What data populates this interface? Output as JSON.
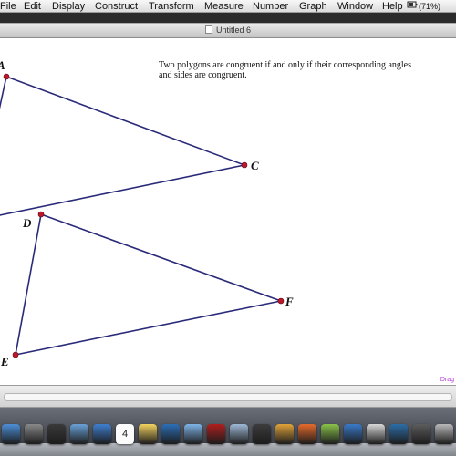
{
  "menubar": {
    "items": [
      "File",
      "Edit",
      "Display",
      "Construct",
      "Transform",
      "Measure",
      "Number",
      "Graph",
      "Window",
      "Help"
    ],
    "battery_text": "(71%)"
  },
  "window": {
    "title": "Untitled 6"
  },
  "canvas": {
    "caption": "Two polygons are congruent if and only if their corresponding angles and sides are congruent.",
    "drag_label": "Drag",
    "points": {
      "A": "A",
      "C": "C",
      "D": "D",
      "E": "E",
      "F": "F"
    },
    "colors": {
      "segment": "#2a2a7a",
      "point": "#c0182a"
    }
  },
  "dock": {
    "icons": [
      "finder-icon",
      "system-icon",
      "app-icon",
      "mail-icon",
      "safari-icon",
      "calendar-icon",
      "notes-icon",
      "iphoto-icon",
      "itunes-icon",
      "photo-booth-icon",
      "preview-icon",
      "quicktime-icon",
      "chrome-icon",
      "firefox-icon",
      "music-icon",
      "app-icon-2",
      "app-icon-3",
      "app-icon-4",
      "app-icon-5",
      "app-icon-6"
    ],
    "calendar_day": "4"
  }
}
